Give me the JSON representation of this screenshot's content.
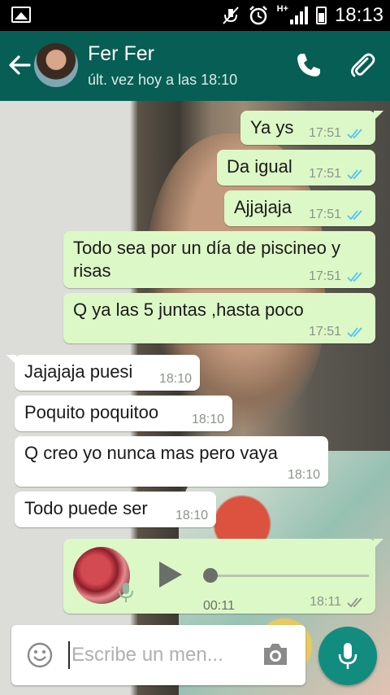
{
  "status_bar": {
    "time": "18:13",
    "network": "H+"
  },
  "header": {
    "contact_name": "Fer Fer",
    "last_seen": "últ. vez hoy a las 18:10"
  },
  "messages": [
    {
      "direction": "out",
      "text": "Ya ys",
      "time": "17:51"
    },
    {
      "direction": "out",
      "text": "Da igual",
      "time": "17:51"
    },
    {
      "direction": "out",
      "text": "Ajjajaja",
      "time": "17:51"
    },
    {
      "direction": "out",
      "text_line1": "Todo sea por un día de piscineo y",
      "text_line2": "risas",
      "time": "17:51"
    },
    {
      "direction": "out",
      "text": "Q ya las 5 juntas ,hasta poco",
      "time": "17:51"
    },
    {
      "direction": "in",
      "text": "Jajajaja puesi",
      "time": "18:10"
    },
    {
      "direction": "in",
      "text": "Poquito poquitoo",
      "time": "18:10"
    },
    {
      "direction": "in",
      "text": "Q creo yo nunca mas pero vaya",
      "time": "18:10"
    },
    {
      "direction": "in",
      "text": "Todo puede ser",
      "time": "18:10"
    }
  ],
  "voice_note": {
    "duration": "00:11",
    "time": "18:11",
    "progress": 0
  },
  "composer": {
    "placeholder": "Escribe un men..."
  },
  "colors": {
    "header": "#075e54",
    "outgoing_bubble": "#dcf8c6",
    "incoming_bubble": "#ffffff",
    "read_ticks": "#4fc3f7",
    "mic_button": "#128c7e"
  }
}
